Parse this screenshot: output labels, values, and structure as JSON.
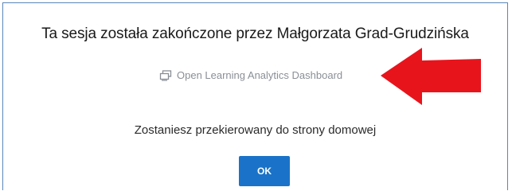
{
  "dialog": {
    "title": "Ta sesja została zakończone przez Małgorzata Grad-Grudzińska",
    "link": {
      "icon": "dashboard-icon",
      "label": "Open Learning Analytics Dashboard"
    },
    "annotation": {
      "icon": "red-arrow-pointing-left",
      "color": "#e8141c"
    },
    "message": "Zostaniesz przekierowany do strony domowej",
    "ok_label": "OK"
  },
  "colors": {
    "accent": "#1a73c8",
    "border": "#5a86b8",
    "link_text": "#8a8f96"
  }
}
